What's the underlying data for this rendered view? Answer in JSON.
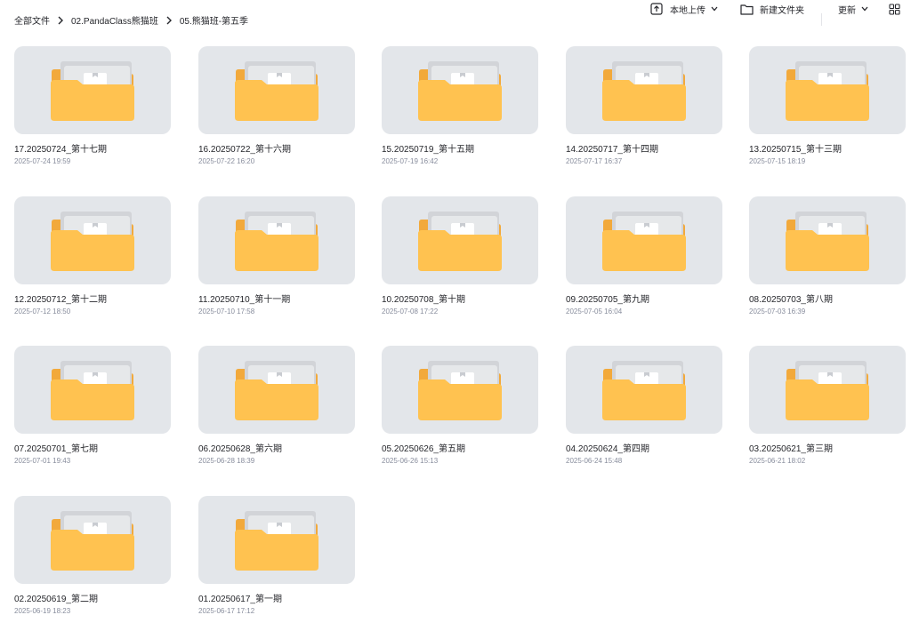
{
  "breadcrumb": {
    "items": [
      "全部文件",
      "02.PandaClass熊猫班",
      "05.熊猫班-第五季"
    ]
  },
  "toolbar": {
    "upload_label": "本地上传",
    "new_folder_label": "新建文件夹",
    "sort_label": "更新"
  },
  "folders": [
    {
      "name": "17.20250724_第十七期",
      "date": "2025-07-24 19:59"
    },
    {
      "name": "16.20250722_第十六期",
      "date": "2025-07-22 16:20"
    },
    {
      "name": "15.20250719_第十五期",
      "date": "2025-07-19 16:42"
    },
    {
      "name": "14.20250717_第十四期",
      "date": "2025-07-17 16:37"
    },
    {
      "name": "13.20250715_第十三期",
      "date": "2025-07-15 18:19"
    },
    {
      "name": "12.20250712_第十二期",
      "date": "2025-07-12 18:50"
    },
    {
      "name": "11.20250710_第十一期",
      "date": "2025-07-10 17:58"
    },
    {
      "name": "10.20250708_第十期",
      "date": "2025-07-08 17:22"
    },
    {
      "name": "09.20250705_第九期",
      "date": "2025-07-05 16:04"
    },
    {
      "name": "08.20250703_第八期",
      "date": "2025-07-03 16:39"
    },
    {
      "name": "07.20250701_第七期",
      "date": "2025-07-01 19:43"
    },
    {
      "name": "06.20250628_第六期",
      "date": "2025-06-28 18:39"
    },
    {
      "name": "05.20250626_第五期",
      "date": "2025-06-26 15:13"
    },
    {
      "name": "04.20250624_第四期",
      "date": "2025-06-24 15:48"
    },
    {
      "name": "03.20250621_第三期",
      "date": "2025-06-21 18:02"
    },
    {
      "name": "02.20250619_第二期",
      "date": "2025-06-19 18:23"
    },
    {
      "name": "01.20250617_第一期",
      "date": "2025-06-17 17:12"
    }
  ],
  "icons": {
    "folder_icon": "folder-icon",
    "upload_icon": "upload-icon",
    "new_folder_icon": "new-folder-icon",
    "sort_icon": "chevron-down-icon",
    "view_icon": "grid-view-icon"
  },
  "colors": {
    "folder_body": "#ffc250",
    "folder_back": "#f2a93b",
    "thumb_bg": "#e3e6ea",
    "text": "#25262b",
    "subtext": "#878c9c"
  }
}
